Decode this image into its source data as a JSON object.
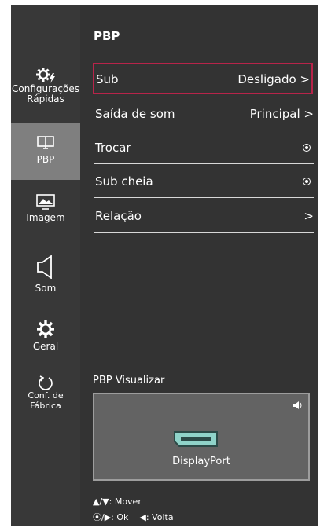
{
  "sidebar": {
    "items": [
      {
        "label_1": "Configurações",
        "label_2": "Rápidas",
        "icon": "gear-flash-icon"
      },
      {
        "label_1": "PBP",
        "label_2": "",
        "icon": "pbp-screen-icon"
      },
      {
        "label_1": "Imagem",
        "label_2": "",
        "icon": "picture-icon"
      },
      {
        "label_1": "Som",
        "label_2": "",
        "icon": "speaker-icon"
      },
      {
        "label_1": "Geral",
        "label_2": "",
        "icon": "gear-icon"
      },
      {
        "label_1": "Conf. de Fábrica",
        "label_2": "",
        "icon": "reset-icon"
      }
    ],
    "active": "PBP"
  },
  "main": {
    "title": "PBP",
    "rows": [
      {
        "label": "Sub",
        "value": "Desligado >",
        "selected": true
      },
      {
        "label": "Saída de som",
        "value": "Principal >"
      },
      {
        "label": "Trocar",
        "value": ""
      },
      {
        "label": "Sub cheia",
        "value": ""
      },
      {
        "label": "Relação",
        "value": ">"
      }
    ],
    "preview_label": "PBP Visualizar",
    "preview_source": "DisplayPort"
  },
  "legend": {
    "line1": "▲/▼: Mover",
    "line2": "⦿/▶: Ok    ◀: Volta"
  },
  "colors": {
    "selection": "#b8244a",
    "active_sidebar": "#7f7f7f",
    "port": "#8fd3c9"
  }
}
